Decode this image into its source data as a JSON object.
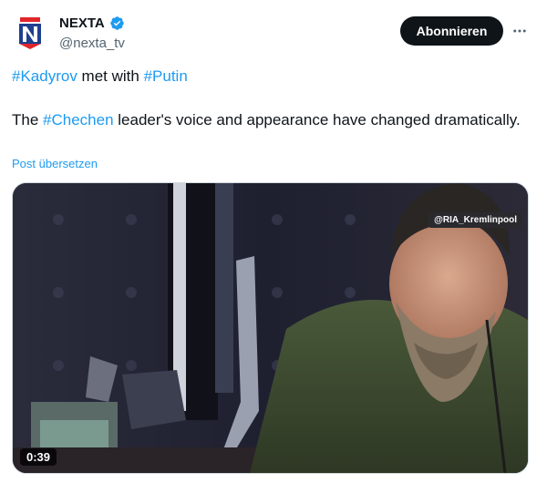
{
  "author": {
    "name": "NEXTA",
    "handle": "@nexta_tv",
    "avatar_icon": "nexta-logo-icon",
    "verified_icon": "verified-badge-icon",
    "verified_color": "#1d9bf0"
  },
  "actions": {
    "follow_label": "Abonnieren",
    "more_icon": "more-dots-icon"
  },
  "post": {
    "line1": {
      "tag1": "#Kadyrov",
      "mid": " met with ",
      "tag2": "#Putin"
    },
    "line2": {
      "prefix": "The ",
      "tag": "#Chechen",
      "rest": " leader's voice and appearance have changed dramatically."
    },
    "translate_label": "Post übersetzen"
  },
  "media": {
    "watermark": "@RIA_Kremlinpool",
    "duration": "0:39"
  },
  "colors": {
    "link": "#1d9bf0",
    "button_bg": "#0f1419",
    "secondary_text": "#536471"
  }
}
